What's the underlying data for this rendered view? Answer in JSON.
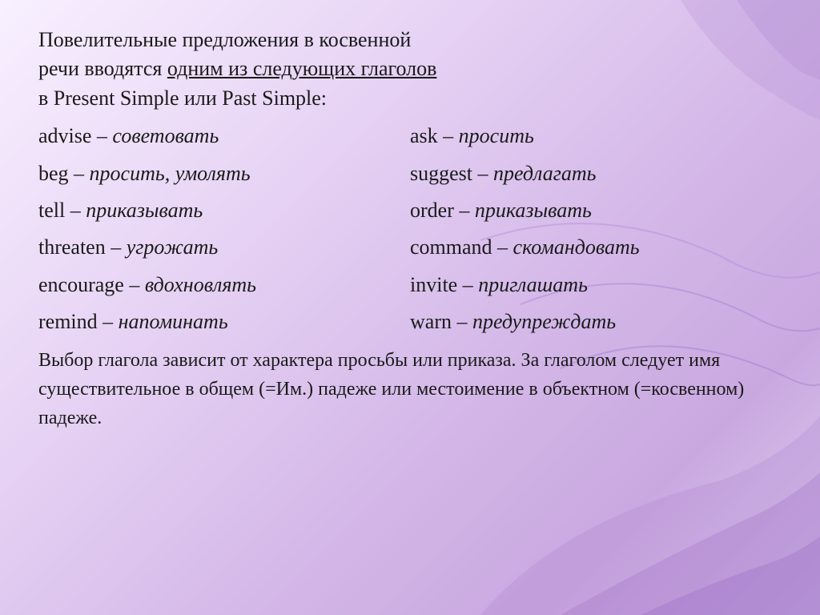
{
  "background": {
    "gradient_desc": "light purple gradient with wave decorations"
  },
  "title": {
    "line1": "Повелительные предложения в косвенной",
    "line2_prefix": "речи вводятся ",
    "line2_underlined": "одним из следующих глаголов",
    "line3": "в  Present Simple  или  Past Simple:"
  },
  "verbs": [
    {
      "en": "advise",
      "ru": "советовать",
      "en2": "ask",
      "ru2": "просить"
    },
    {
      "en": "beg",
      "ru": "просить, умолять",
      "en2": "suggest",
      "ru2": "предлагать"
    },
    {
      "en": "tell",
      "ru": "приказывать",
      "en2": "order",
      "ru2": "приказывать"
    },
    {
      "en": "threaten",
      "ru": "угрожать",
      "en2": "command",
      "ru2": "скомандовать"
    },
    {
      "en": "encourage",
      "ru": "вдохновлять",
      "en2": "invite",
      "ru2": "приглашать"
    },
    {
      "en": "remind",
      "ru": "напоминать",
      "en2": "warn",
      "ru2": "предупреждать"
    }
  ],
  "footer": {
    "text": "Выбор глагола зависит от характера просьбы или приказа. За глаголом следует имя существительное в общем (=Им.) падеже или местоимение в объектном (=косвенном) падеже."
  }
}
